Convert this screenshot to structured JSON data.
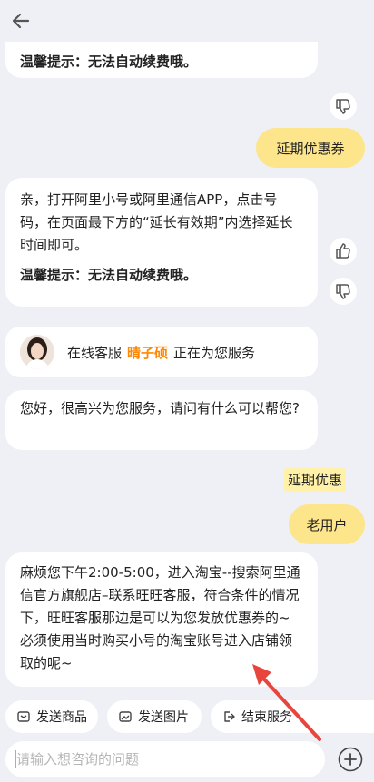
{
  "header": {
    "back_icon": "arrow-left-icon"
  },
  "messages": {
    "tip_partial": "温馨提示：无法自动续费哦。",
    "user_msg_1": "延期优惠券",
    "bot_reply_1": "亲，打开阿里小号或阿里通信APP，点击号码，在页面最下方的“延长有效期”内选择延长时间即可。",
    "bot_reply_1_tip": "温馨提示：无法自动续费哦。",
    "agent_prefix": "在线客服",
    "agent_name": "晴子硕",
    "agent_suffix": "正在为您服务",
    "agent_greeting": "您好，很高兴为您服务，请问有什么可以帮您?",
    "user_typing_highlight": "延期优惠",
    "user_msg_2": "老用户",
    "agent_reply": "麻烦您下午2:00-5:00，进入淘宝--搜索阿里通信官方旗舰店–联系旺旺客服，符合条件的情况下，旺旺客服那边是可以为您发放优惠券的~  必须使用当时购买小号的淘宝账号进入店铺领取的呢~"
  },
  "quick_actions": [
    {
      "label": "发送商品",
      "icon": "box-icon"
    },
    {
      "label": "发送图片",
      "icon": "image-icon"
    },
    {
      "label": "结束服务",
      "icon": "exit-icon"
    }
  ],
  "input": {
    "placeholder": "请输入想咨询的问题",
    "value": ""
  },
  "colors": {
    "background": "#eef0f6",
    "user_bubble": "#fce58a",
    "accent": "#ff8800",
    "annotation_arrow": "#e8453c"
  }
}
